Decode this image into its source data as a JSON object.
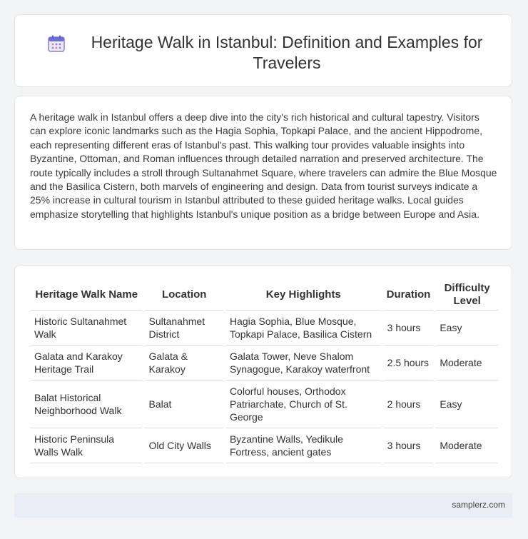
{
  "header": {
    "title": "Heritage Walk in Istanbul: Definition and Examples for Travelers"
  },
  "intro": {
    "text": "A heritage walk in Istanbul offers a deep dive into the city's rich historical and cultural tapestry. Visitors can explore iconic landmarks such as the Hagia Sophia, Topkapi Palace, and the ancient Hippodrome, each representing different eras of Istanbul's past. This walking tour provides valuable insights into Byzantine, Ottoman, and Roman influences through detailed narration and preserved architecture. The route typically includes a stroll through Sultanahmet Square, where travelers can admire the Blue Mosque and the Basilica Cistern, both marvels of engineering and design. Data from tourist surveys indicate a 25% increase in cultural tourism in Istanbul attributed to these guided heritage walks. Local guides emphasize storytelling that highlights Istanbul's unique position as a bridge between Europe and Asia."
  },
  "table": {
    "headers": [
      "Heritage Walk Name",
      "Location",
      "Key Highlights",
      "Duration",
      "Difficulty Level"
    ],
    "rows": [
      [
        "Historic Sultanahmet Walk",
        "Sultanahmet District",
        "Hagia Sophia, Blue Mosque, Topkapi Palace, Basilica Cistern",
        "3 hours",
        "Easy"
      ],
      [
        "Galata and Karakoy Heritage Trail",
        "Galata & Karakoy",
        "Galata Tower, Neve Shalom Synagogue, Karakoy waterfront",
        "2.5 hours",
        "Moderate"
      ],
      [
        "Balat Historical Neighborhood Walk",
        "Balat",
        "Colorful houses, Orthodox Patriarchate, Church of St. George",
        "2 hours",
        "Easy"
      ],
      [
        "Historic Peninsula Walls Walk",
        "Old City Walls",
        "Byzantine Walls, Yedikule Fortress, ancient gates",
        "3 hours",
        "Moderate"
      ]
    ]
  },
  "footer": {
    "site": "samplerz.com"
  },
  "icons": {
    "header_icon": "calendar-icon"
  },
  "colors": {
    "icon_accent": "#8b7fd6",
    "icon_top": "#6b6fd8"
  }
}
